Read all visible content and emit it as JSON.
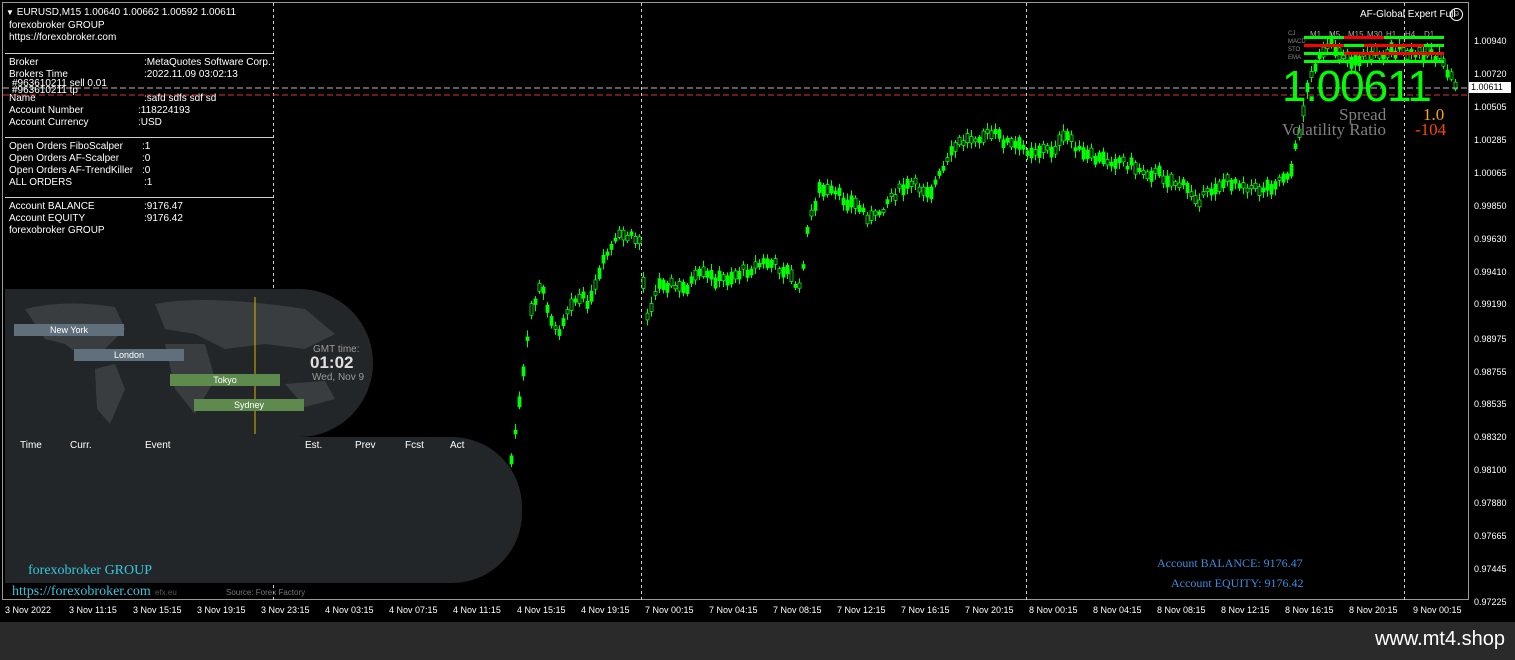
{
  "chart_header": {
    "symbol_line": "EURUSD,M15  1.00640 1.00662 1.00592 1.00611",
    "broker_group": "forexobroker GROUP",
    "url": "https://forexobroker.com"
  },
  "account_info": {
    "broker_label": "Broker",
    "broker_value": ":MetaQuotes Software Corp.",
    "time_label": "Brokers Time",
    "time_value": ":2022.11.09 03:02:13",
    "name_label": "Name",
    "name_value": ":safd   sdfs sdf  sd",
    "order_line_1": "#963610211 sell 0.01",
    "order_line_2": "#963610211 tp",
    "accnum_label": "Account Number",
    "accnum_value": ":118224193",
    "currency_label": "Account Currency",
    "currency_value": ":USD",
    "fibo_label": "Open Orders FiboScalper",
    "fibo_value": ":1",
    "afscalper_label": "Open Orders AF-Scalper",
    "afscalper_value": ":0",
    "trendkiller_label": "Open Orders AF-TrendKiller",
    "trendkiller_value": ":0",
    "all_label": "ALL ORDERS",
    "all_value": ":1",
    "balance_label": "Account BALANCE",
    "balance_value": ":9176.47",
    "equity_label": "Account EQUITY",
    "equity_value": ":9176.42",
    "footer_group": "forexobroker GROUP"
  },
  "expert": {
    "name": "AF-Global Expert Full",
    "price_big": "1.00611",
    "spread_label": "Spread",
    "spread_value": "1.0",
    "vol_label": "Volatility Ratio",
    "vol_value": "-104",
    "tf_labels": [
      "M1",
      "M5",
      "M15",
      "M30",
      "H1",
      "H4",
      "D1"
    ],
    "ind_labels": [
      "CJ",
      "MACD",
      "STO",
      "EMA"
    ]
  },
  "session_map": {
    "gmt_label": "GMT time:",
    "gmt_time": "01:02",
    "gmt_date": "Wed, Nov 9",
    "sessions": [
      "New York",
      "London",
      "Tokyo",
      "Sydney"
    ]
  },
  "calendar": {
    "headers": [
      "Time",
      "Curr.",
      "Event",
      "Est.",
      "Prev",
      "Fcst",
      "Act"
    ],
    "source": "Source: Forex Factory",
    "group": "forexobroker GROUP",
    "url": "https://forexobroker.com",
    "credit_partial": "efx.eu"
  },
  "bottom_right": {
    "balance": "Account BALANCE:  9176.47",
    "equity": "Account EQUITY:  9176.42"
  },
  "price_axis": [
    "1.00940",
    "1.00720",
    "1.00611",
    "1.00505",
    "1.00285",
    "1.00065",
    "0.99850",
    "0.99630",
    "0.99410",
    "0.99190",
    "0.98975",
    "0.98755",
    "0.98535",
    "0.98320",
    "0.98100",
    "0.97880",
    "0.97665",
    "0.97445",
    "0.97225"
  ],
  "time_axis": [
    "3 Nov 2022",
    "3 Nov 11:15",
    "3 Nov 15:15",
    "3 Nov 19:15",
    "3 Nov 23:15",
    "4 Nov 03:15",
    "4 Nov 07:15",
    "4 Nov 11:15",
    "4 Nov 15:15",
    "4 Nov 19:15",
    "7 Nov 00:15",
    "7 Nov 04:15",
    "7 Nov 08:15",
    "7 Nov 12:15",
    "7 Nov 16:15",
    "7 Nov 20:15",
    "8 Nov 00:15",
    "8 Nov 04:15",
    "8 Nov 08:15",
    "8 Nov 12:15",
    "8 Nov 16:15",
    "8 Nov 20:15",
    "9 Nov 00:15"
  ],
  "current_price": "1.00611",
  "footer_site": "www.mt4.shop",
  "colors": {
    "candle": "#00ff00",
    "big_price": "#00ff00",
    "bid_line": "#cfcfcf",
    "order_line": "#ff3333",
    "spread_val": "#ffa500",
    "vol_val": "#ff4500",
    "blue_text": "#3a8dde"
  }
}
